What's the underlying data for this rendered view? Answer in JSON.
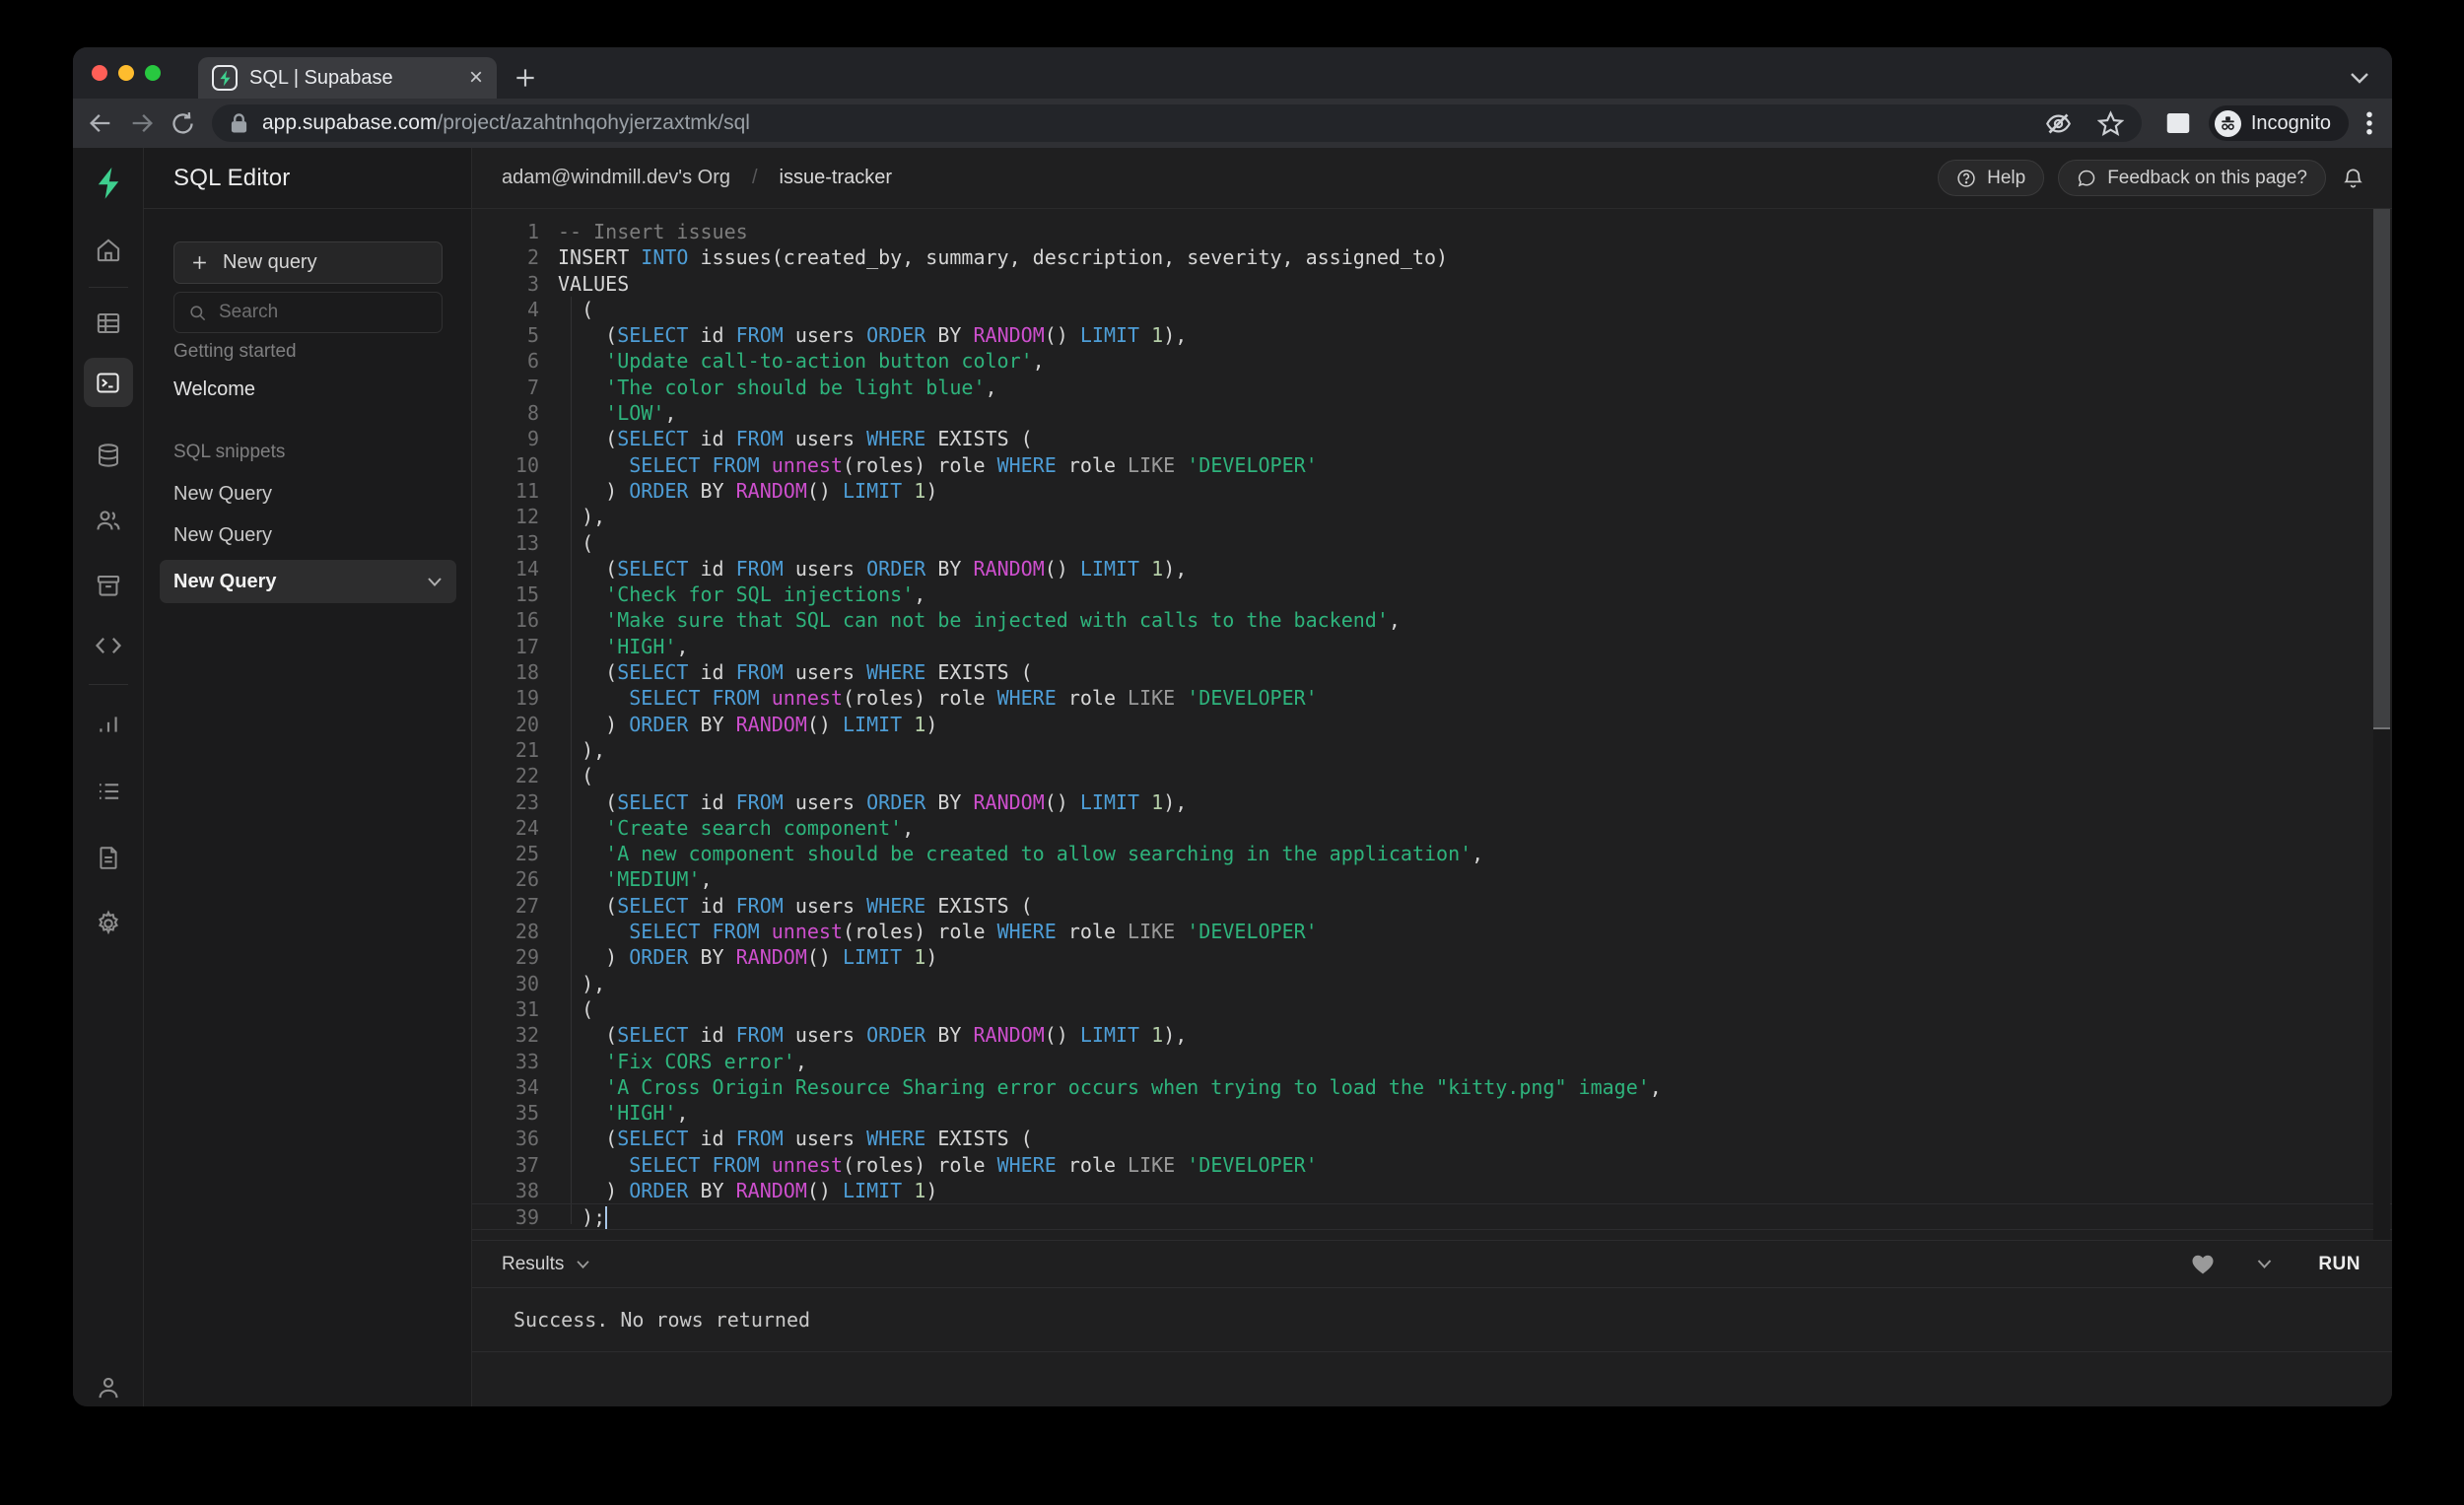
{
  "colors": {
    "accent": "#3ecf8e",
    "kw": "#4d9dd6",
    "fn": "#cd4fcd",
    "str": "#2eb37c",
    "comment": "#7d7d7d",
    "op": "#9a9a9a",
    "num": "#b5cea8",
    "plain": "#d6d6d6"
  },
  "browser": {
    "tab_title": "SQL | Supabase",
    "url_host": "app.supabase.com",
    "url_path": "/project/azahtnhqohyjerzaxtmk/sql",
    "incognito_label": "Incognito"
  },
  "rail_icons": [
    "supabase-logo",
    "home",
    "table",
    "terminal",
    "database",
    "users",
    "archive",
    "code",
    "bar-chart",
    "list",
    "file",
    "gear",
    "user"
  ],
  "panel": {
    "title": "SQL Editor",
    "new_query": "New query",
    "search_placeholder": "Search",
    "sections": [
      {
        "label": "Getting started",
        "items": [
          {
            "label": "Welcome",
            "selected": false
          }
        ]
      },
      {
        "label": "SQL snippets",
        "items": [
          {
            "label": "New Query",
            "selected": false
          },
          {
            "label": "New Query",
            "selected": false
          },
          {
            "label": "New Query",
            "selected": true
          }
        ]
      }
    ]
  },
  "header": {
    "org": "adam@windmill.dev's Org",
    "separator": "/",
    "project": "issue-tracker",
    "help_label": "Help",
    "feedback_label": "Feedback on this page?"
  },
  "editor": {
    "line_count": 39,
    "cursor_line": 39,
    "lines": [
      [
        [
          "-- Insert issues",
          "c"
        ]
      ],
      [
        [
          "INSERT ",
          "w"
        ],
        [
          "INTO",
          "k"
        ],
        [
          " issues(created_by, summary, description, severity, assigned_to)",
          "w"
        ]
      ],
      [
        [
          "VALUES",
          "w"
        ]
      ],
      [
        [
          "  (",
          "w"
        ]
      ],
      [
        [
          "    (",
          "w"
        ],
        [
          "SELECT",
          "k"
        ],
        [
          " id ",
          "w"
        ],
        [
          "FROM",
          "k"
        ],
        [
          " users ",
          "w"
        ],
        [
          "ORDER",
          "k"
        ],
        [
          " BY ",
          "w"
        ],
        [
          "RANDOM",
          "f"
        ],
        [
          "() ",
          "w"
        ],
        [
          "LIMIT",
          "k"
        ],
        [
          " ",
          "w"
        ],
        [
          "1",
          "n"
        ],
        [
          "),",
          "w"
        ]
      ],
      [
        [
          "    ",
          "w"
        ],
        [
          "'Update call-to-action button color'",
          "s"
        ],
        [
          ",",
          "w"
        ]
      ],
      [
        [
          "    ",
          "w"
        ],
        [
          "'The color should be light blue'",
          "s"
        ],
        [
          ",",
          "w"
        ]
      ],
      [
        [
          "    ",
          "w"
        ],
        [
          "'LOW'",
          "s"
        ],
        [
          ",",
          "w"
        ]
      ],
      [
        [
          "    (",
          "w"
        ],
        [
          "SELECT",
          "k"
        ],
        [
          " id ",
          "w"
        ],
        [
          "FROM",
          "k"
        ],
        [
          " users ",
          "w"
        ],
        [
          "WHERE",
          "k"
        ],
        [
          " EXISTS (",
          "w"
        ]
      ],
      [
        [
          "      ",
          "w"
        ],
        [
          "SELECT",
          "k"
        ],
        [
          " ",
          "w"
        ],
        [
          "FROM",
          "k"
        ],
        [
          " ",
          "w"
        ],
        [
          "unnest",
          "f"
        ],
        [
          "(roles) role ",
          "w"
        ],
        [
          "WHERE",
          "k"
        ],
        [
          " role ",
          "w"
        ],
        [
          "LIKE",
          "o"
        ],
        [
          " ",
          "w"
        ],
        [
          "'DEVELOPER'",
          "s"
        ]
      ],
      [
        [
          "    ) ",
          "w"
        ],
        [
          "ORDER",
          "k"
        ],
        [
          " BY ",
          "w"
        ],
        [
          "RANDOM",
          "f"
        ],
        [
          "() ",
          "w"
        ],
        [
          "LIMIT",
          "k"
        ],
        [
          " ",
          "w"
        ],
        [
          "1",
          "n"
        ],
        [
          ")",
          "w"
        ]
      ],
      [
        [
          "  ),",
          "w"
        ]
      ],
      [
        [
          "  (",
          "w"
        ]
      ],
      [
        [
          "    (",
          "w"
        ],
        [
          "SELECT",
          "k"
        ],
        [
          " id ",
          "w"
        ],
        [
          "FROM",
          "k"
        ],
        [
          " users ",
          "w"
        ],
        [
          "ORDER",
          "k"
        ],
        [
          " BY ",
          "w"
        ],
        [
          "RANDOM",
          "f"
        ],
        [
          "() ",
          "w"
        ],
        [
          "LIMIT",
          "k"
        ],
        [
          " ",
          "w"
        ],
        [
          "1",
          "n"
        ],
        [
          "),",
          "w"
        ]
      ],
      [
        [
          "    ",
          "w"
        ],
        [
          "'Check for SQL injections'",
          "s"
        ],
        [
          ",",
          "w"
        ]
      ],
      [
        [
          "    ",
          "w"
        ],
        [
          "'Make sure that SQL can not be injected with calls to the backend'",
          "s"
        ],
        [
          ",",
          "w"
        ]
      ],
      [
        [
          "    ",
          "w"
        ],
        [
          "'HIGH'",
          "s"
        ],
        [
          ",",
          "w"
        ]
      ],
      [
        [
          "    (",
          "w"
        ],
        [
          "SELECT",
          "k"
        ],
        [
          " id ",
          "w"
        ],
        [
          "FROM",
          "k"
        ],
        [
          " users ",
          "w"
        ],
        [
          "WHERE",
          "k"
        ],
        [
          " EXISTS (",
          "w"
        ]
      ],
      [
        [
          "      ",
          "w"
        ],
        [
          "SELECT",
          "k"
        ],
        [
          " ",
          "w"
        ],
        [
          "FROM",
          "k"
        ],
        [
          " ",
          "w"
        ],
        [
          "unnest",
          "f"
        ],
        [
          "(roles) role ",
          "w"
        ],
        [
          "WHERE",
          "k"
        ],
        [
          " role ",
          "w"
        ],
        [
          "LIKE",
          "o"
        ],
        [
          " ",
          "w"
        ],
        [
          "'DEVELOPER'",
          "s"
        ]
      ],
      [
        [
          "    ) ",
          "w"
        ],
        [
          "ORDER",
          "k"
        ],
        [
          " BY ",
          "w"
        ],
        [
          "RANDOM",
          "f"
        ],
        [
          "() ",
          "w"
        ],
        [
          "LIMIT",
          "k"
        ],
        [
          " ",
          "w"
        ],
        [
          "1",
          "n"
        ],
        [
          ")",
          "w"
        ]
      ],
      [
        [
          "  ),",
          "w"
        ]
      ],
      [
        [
          "  (",
          "w"
        ]
      ],
      [
        [
          "    (",
          "w"
        ],
        [
          "SELECT",
          "k"
        ],
        [
          " id ",
          "w"
        ],
        [
          "FROM",
          "k"
        ],
        [
          " users ",
          "w"
        ],
        [
          "ORDER",
          "k"
        ],
        [
          " BY ",
          "w"
        ],
        [
          "RANDOM",
          "f"
        ],
        [
          "() ",
          "w"
        ],
        [
          "LIMIT",
          "k"
        ],
        [
          " ",
          "w"
        ],
        [
          "1",
          "n"
        ],
        [
          "),",
          "w"
        ]
      ],
      [
        [
          "    ",
          "w"
        ],
        [
          "'Create search component'",
          "s"
        ],
        [
          ",",
          "w"
        ]
      ],
      [
        [
          "    ",
          "w"
        ],
        [
          "'A new component should be created to allow searching in the application'",
          "s"
        ],
        [
          ",",
          "w"
        ]
      ],
      [
        [
          "    ",
          "w"
        ],
        [
          "'MEDIUM'",
          "s"
        ],
        [
          ",",
          "w"
        ]
      ],
      [
        [
          "    (",
          "w"
        ],
        [
          "SELECT",
          "k"
        ],
        [
          " id ",
          "w"
        ],
        [
          "FROM",
          "k"
        ],
        [
          " users ",
          "w"
        ],
        [
          "WHERE",
          "k"
        ],
        [
          " EXISTS (",
          "w"
        ]
      ],
      [
        [
          "      ",
          "w"
        ],
        [
          "SELECT",
          "k"
        ],
        [
          " ",
          "w"
        ],
        [
          "FROM",
          "k"
        ],
        [
          " ",
          "w"
        ],
        [
          "unnest",
          "f"
        ],
        [
          "(roles) role ",
          "w"
        ],
        [
          "WHERE",
          "k"
        ],
        [
          " role ",
          "w"
        ],
        [
          "LIKE",
          "o"
        ],
        [
          " ",
          "w"
        ],
        [
          "'DEVELOPER'",
          "s"
        ]
      ],
      [
        [
          "    ) ",
          "w"
        ],
        [
          "ORDER",
          "k"
        ],
        [
          " BY ",
          "w"
        ],
        [
          "RANDOM",
          "f"
        ],
        [
          "() ",
          "w"
        ],
        [
          "LIMIT",
          "k"
        ],
        [
          " ",
          "w"
        ],
        [
          "1",
          "n"
        ],
        [
          ")",
          "w"
        ]
      ],
      [
        [
          "  ),",
          "w"
        ]
      ],
      [
        [
          "  (",
          "w"
        ]
      ],
      [
        [
          "    (",
          "w"
        ],
        [
          "SELECT",
          "k"
        ],
        [
          " id ",
          "w"
        ],
        [
          "FROM",
          "k"
        ],
        [
          " users ",
          "w"
        ],
        [
          "ORDER",
          "k"
        ],
        [
          " BY ",
          "w"
        ],
        [
          "RANDOM",
          "f"
        ],
        [
          "() ",
          "w"
        ],
        [
          "LIMIT",
          "k"
        ],
        [
          " ",
          "w"
        ],
        [
          "1",
          "n"
        ],
        [
          "),",
          "w"
        ]
      ],
      [
        [
          "    ",
          "w"
        ],
        [
          "'Fix CORS error'",
          "s"
        ],
        [
          ",",
          "w"
        ]
      ],
      [
        [
          "    ",
          "w"
        ],
        [
          "'A Cross Origin Resource Sharing error occurs when trying to load the \"kitty.png\" image'",
          "s"
        ],
        [
          ",",
          "w"
        ]
      ],
      [
        [
          "    ",
          "w"
        ],
        [
          "'HIGH'",
          "s"
        ],
        [
          ",",
          "w"
        ]
      ],
      [
        [
          "    (",
          "w"
        ],
        [
          "SELECT",
          "k"
        ],
        [
          " id ",
          "w"
        ],
        [
          "FROM",
          "k"
        ],
        [
          " users ",
          "w"
        ],
        [
          "WHERE",
          "k"
        ],
        [
          " EXISTS (",
          "w"
        ]
      ],
      [
        [
          "      ",
          "w"
        ],
        [
          "SELECT",
          "k"
        ],
        [
          " ",
          "w"
        ],
        [
          "FROM",
          "k"
        ],
        [
          " ",
          "w"
        ],
        [
          "unnest",
          "f"
        ],
        [
          "(roles) role ",
          "w"
        ],
        [
          "WHERE",
          "k"
        ],
        [
          " role ",
          "w"
        ],
        [
          "LIKE",
          "o"
        ],
        [
          " ",
          "w"
        ],
        [
          "'DEVELOPER'",
          "s"
        ]
      ],
      [
        [
          "    ) ",
          "w"
        ],
        [
          "ORDER",
          "k"
        ],
        [
          " BY ",
          "w"
        ],
        [
          "RANDOM",
          "f"
        ],
        [
          "() ",
          "w"
        ],
        [
          "LIMIT",
          "k"
        ],
        [
          " ",
          "w"
        ],
        [
          "1",
          "n"
        ],
        [
          ")",
          "w"
        ]
      ],
      [
        [
          "  );",
          "w"
        ]
      ]
    ]
  },
  "results": {
    "panel_label": "Results",
    "run_label": "RUN",
    "output": "Success. No rows returned"
  }
}
